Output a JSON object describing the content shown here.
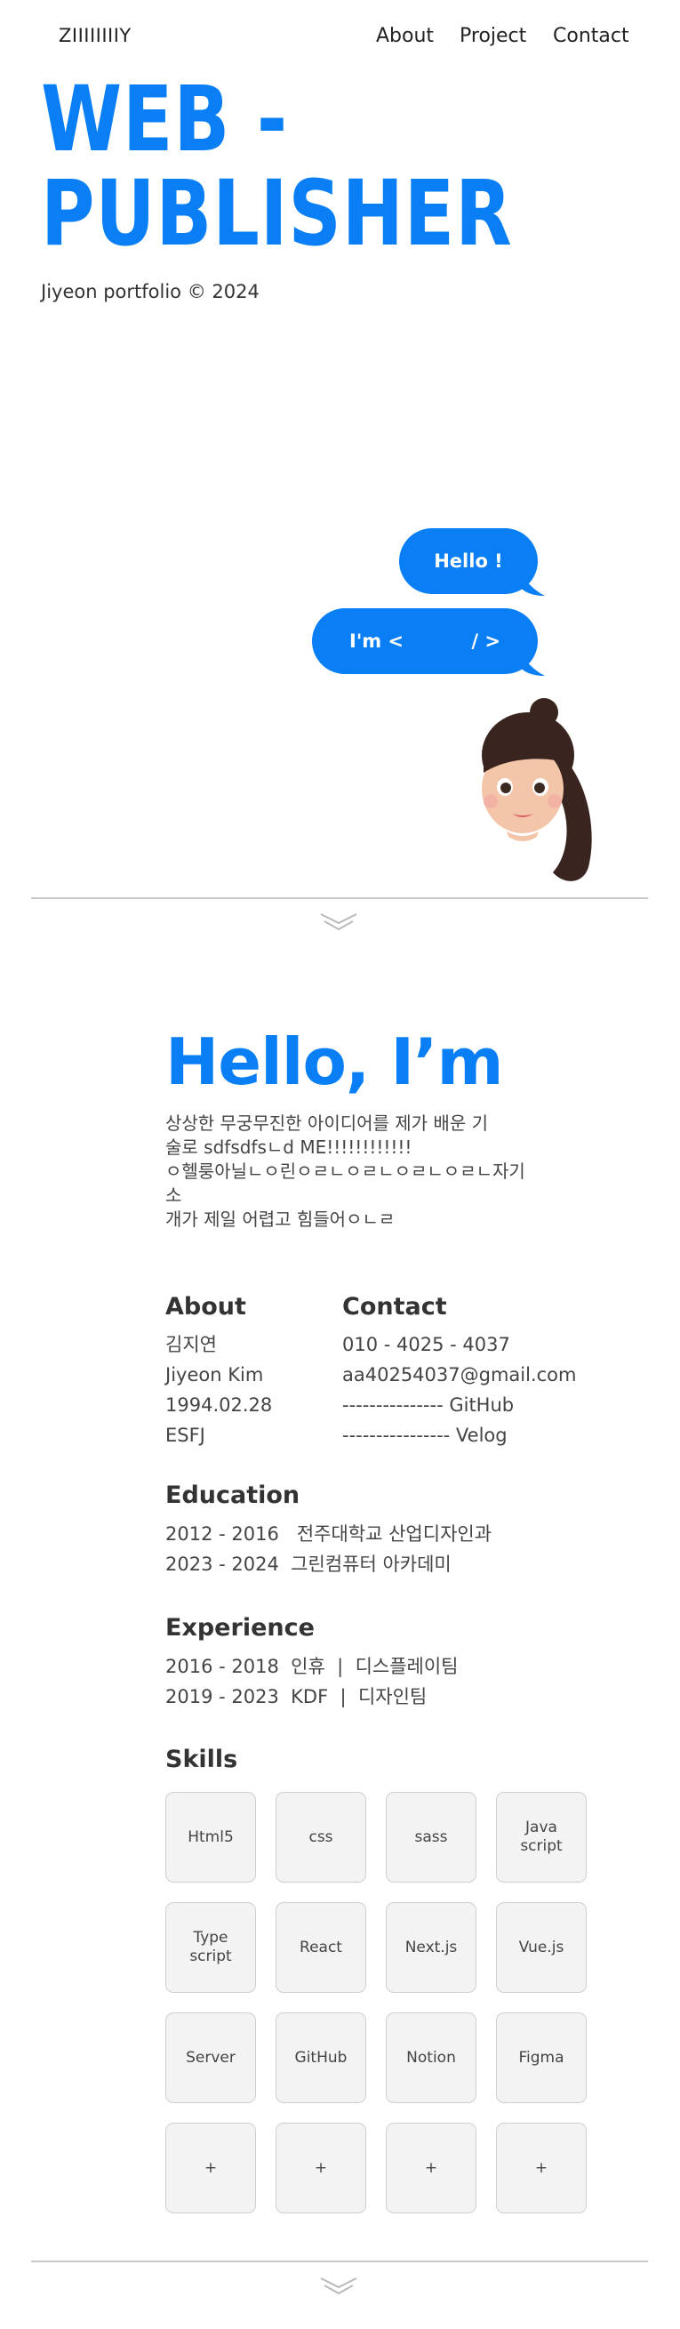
{
  "header": {
    "logo": "ZIIIIIIIIY",
    "nav": [
      "About",
      "Project",
      "Contact"
    ]
  },
  "hero": {
    "title_line1": "WEB -",
    "title_line2": "PUBLISHER",
    "subtitle": "Jiyeon portfolio © 2024"
  },
  "chat": {
    "bubble1": "Hello !",
    "bubble2_left": "I'm <",
    "bubble2_right": "/ >"
  },
  "intro": {
    "heading": "Hello, I’m",
    "lines": [
      "상상한 무궁무진한 아이디어를 제가 배운 기",
      "술로 sdfsdfsㄴd ME!!!!!!!!!!!!",
      "ㅇ헬룽아닐ㄴㅇ린ㅇㄹㄴㅇㄹㄴㅇㄹㄴㅇㄹㄴ자기소",
      "개가 제일 어렵고 힘들어ㅇㄴㄹ"
    ]
  },
  "about": {
    "title": "About",
    "items": [
      "김지연",
      "Jiyeon Kim",
      "1994.02.28",
      "ESFJ"
    ]
  },
  "contact": {
    "title": "Contact",
    "phone": "010 - 4025 - 4037",
    "email": "aa40254037@gmail.com",
    "github": "--------------- GitHub",
    "velog": "---------------- Velog"
  },
  "education": {
    "title": "Education",
    "items": [
      "2012 - 2016   전주대학교 산업디자인과",
      "2023 - 2024  그린컴퓨터 아카데미"
    ]
  },
  "experience": {
    "title": "Experience",
    "items": [
      "2016 - 2018  인휴  |  디스플레이팀",
      "2019 - 2023  KDF  |  디자인팀"
    ]
  },
  "skills": {
    "title": "Skills",
    "items": [
      "Html5",
      "css",
      "sass",
      "Java\nscript",
      "Type\nscript",
      "React",
      "Next.js",
      "Vue.js",
      "Server",
      "GitHub",
      "Notion",
      "Figma",
      "+",
      "+",
      "+",
      "+"
    ]
  },
  "colors": {
    "accent": "#0a7ff5",
    "skill_bg": "#f3f3f3",
    "divider": "#c8c8c8"
  },
  "icons": {
    "scroll_down": "double-chevron-down-icon",
    "avatar": "memoji-avatar"
  }
}
